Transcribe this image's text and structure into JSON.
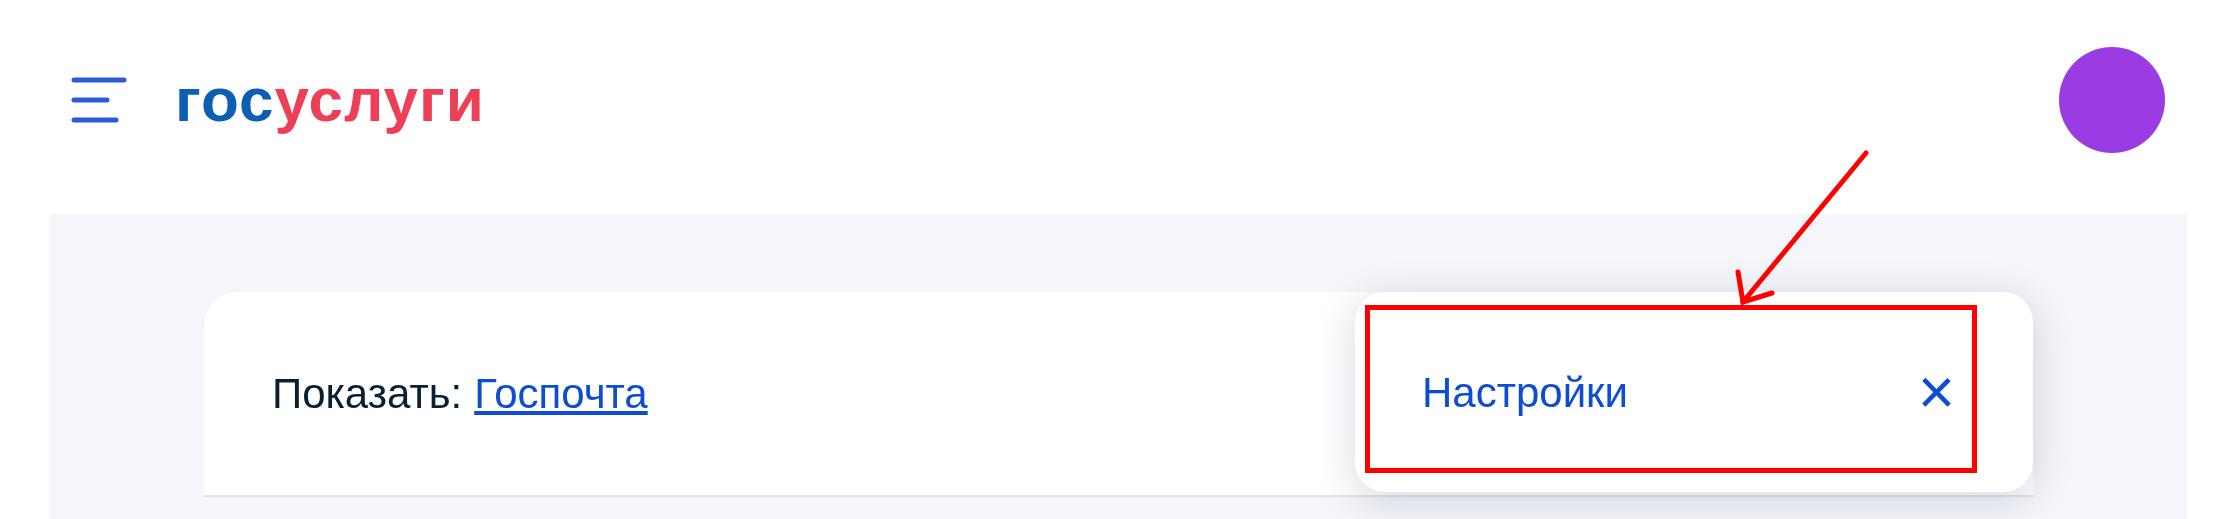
{
  "header": {
    "logo": [
      "гос",
      "услуги"
    ]
  },
  "filter": {
    "label": "Показать:",
    "link": "Госпочта"
  },
  "popup": {
    "item": "Настройки",
    "close": "×"
  }
}
